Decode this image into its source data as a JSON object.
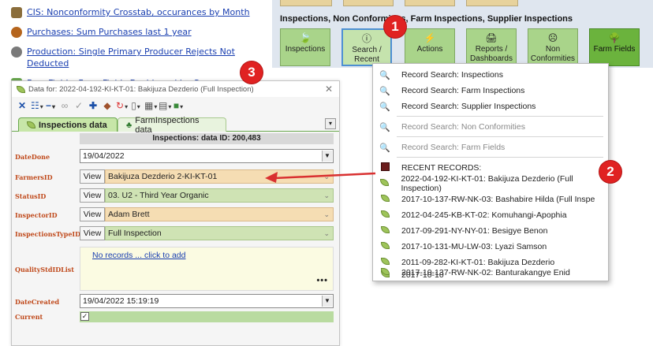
{
  "links": [
    {
      "text": "CIS: Nonconformity Crosstab, occurances by Month",
      "icon": "chart-icon"
    },
    {
      "text": "Purchases: Sum Purchases last 1 year",
      "icon": "coffee-bean-icon"
    },
    {
      "text": "Production: Single Primary Producer Rejects Not Deducted",
      "icon": "gear-icon"
    },
    {
      "text": "FarmFields: Farm Fields Dashboard by Crop",
      "icon": "field-icon"
    }
  ],
  "toolbar": {
    "header": "Inspections, Non Conformities, Farm Inspections, Supplier Inspections",
    "buttons": [
      {
        "label": "Inspections",
        "icon": "leaf-icon"
      },
      {
        "label": "Search / Recent",
        "icon": "info-icon"
      },
      {
        "label": "Actions",
        "icon": "lightning-icon"
      },
      {
        "label": "Reports / Dashboards",
        "icon": "printer-icon"
      },
      {
        "label": "Non Conformities",
        "icon": "face-icon"
      },
      {
        "label": "Farm Fields",
        "icon": "tree-icon"
      }
    ]
  },
  "callouts": [
    "1",
    "2",
    "3"
  ],
  "menu": {
    "items": [
      {
        "label": "Record Search: Inspections",
        "enabled": true
      },
      {
        "label": "Record Search: Farm Inspections",
        "enabled": true
      },
      {
        "label": "Record Search: Supplier Inspections",
        "enabled": true
      },
      {
        "label": "Record Search: Non Conformities",
        "enabled": false
      },
      {
        "label": "Record Search: Farm Fields",
        "enabled": false
      }
    ],
    "recent_header": "RECENT RECORDS:",
    "recent": [
      "2022-04-192-KI-KT-01: Bakijuza Dezderio (Full Inspection)",
      "2017-10-137-RW-NK-03: Bashabire Hilda (Full Inspe",
      "2012-04-245-KB-KT-02: Komuhangi-Apophia",
      "2017-09-291-NY-NY-01: Besigye Benon",
      "2017-10-131-MU-LW-03: Lyazi Samson",
      "2011-09-282-KI-KT-01: Bakijuza Dezderio",
      "2017-10-10",
      "2017-10-137-RW-NK-02: Banturakangye Enid"
    ]
  },
  "window": {
    "title": "Data for: 2022-04-192-KI-KT-01: Bakijuza Dezderio (Full Inspection)",
    "tabs": [
      "Inspections data",
      "FarmInspections data"
    ],
    "form_header": "Inspections: data ID: 200,483",
    "view_label": "View",
    "fields": {
      "date_done": {
        "label": "DateDone",
        "value": "19/04/2022"
      },
      "farmers_id": {
        "label": "FarmersID",
        "value": "Bakijuza Dezderio 2-KI-KT-01"
      },
      "status_id": {
        "label": "StatusID",
        "value": "03. U2 - Third Year Organic"
      },
      "inspector_id": {
        "label": "InspectorID",
        "value": "Adam Brett"
      },
      "inspections_type_id": {
        "label": "InspectionsTypeID",
        "value": "Full Inspection"
      },
      "quality_std": {
        "label": "QualityStdIDList",
        "value": "No records ... click to add",
        "dots": "•••"
      },
      "date_created": {
        "label": "DateCreated",
        "value": "19/04/2022 15:19:19"
      },
      "current": {
        "label": "Current",
        "checked": "✓"
      }
    }
  },
  "colors": {
    "accent_green": "#a9d48a",
    "tan_field": "#f5ddb3",
    "green_field": "#cfe3b4",
    "callout_red": "#e02222",
    "link_blue": "#1a3fb0"
  }
}
